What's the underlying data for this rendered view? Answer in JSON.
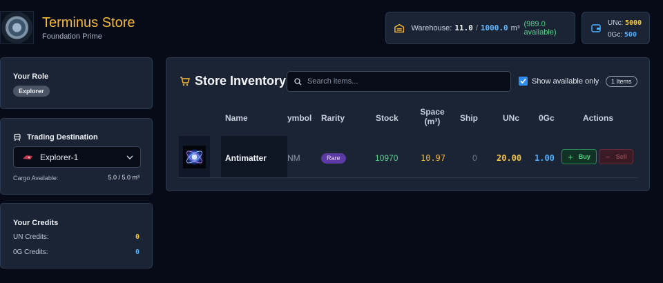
{
  "header": {
    "title": "Terminus Store",
    "subtitle": "Foundation Prime"
  },
  "warehouse": {
    "label": "Warehouse:",
    "used": "11.0",
    "capacity": "1000.0",
    "unit": "m³",
    "available": "(989.0 available)"
  },
  "top_credits": {
    "unc_label": "UNc:",
    "unc_value": "5000",
    "ogc_label": "0Gc:",
    "ogc_value": "500"
  },
  "role": {
    "title": "Your Role",
    "value": "Explorer"
  },
  "destination": {
    "title": "Trading Destination",
    "selected": "Explorer-1",
    "cargo_label": "Cargo Available:",
    "cargo_value": "5.0 / 5.0 m³"
  },
  "credits": {
    "title": "Your Credits",
    "un_label": "UN Credits:",
    "un_value": "0",
    "og_label": "0G Credits:",
    "og_value": "0"
  },
  "inventory": {
    "title": "Store Inventory",
    "search_placeholder": "Search items...",
    "filter_label": "Show available only",
    "items_count": "1 Items",
    "columns": {
      "name": "Name",
      "symbol": "ymbol",
      "rarity": "Rarity",
      "stock": "Stock",
      "space_line1": "Space",
      "space_line2": "(m³)",
      "ship": "Ship",
      "unc": "UNc",
      "ogc": "0Gc",
      "actions": "Actions"
    },
    "rows": [
      {
        "name": "Antimatter",
        "symbol": "NM",
        "rarity": "Rare",
        "stock": "10970",
        "space": "10.97",
        "ship": "0",
        "unc": "20.00",
        "ogc": "1.00",
        "buy": "Buy",
        "sell": "Sell"
      }
    ]
  },
  "colors": {
    "accent": "#f5b93a",
    "unc": "#f5c542",
    "ogc": "#4fb0ff",
    "green": "#56d68b",
    "rare": "#5b3aa3"
  }
}
